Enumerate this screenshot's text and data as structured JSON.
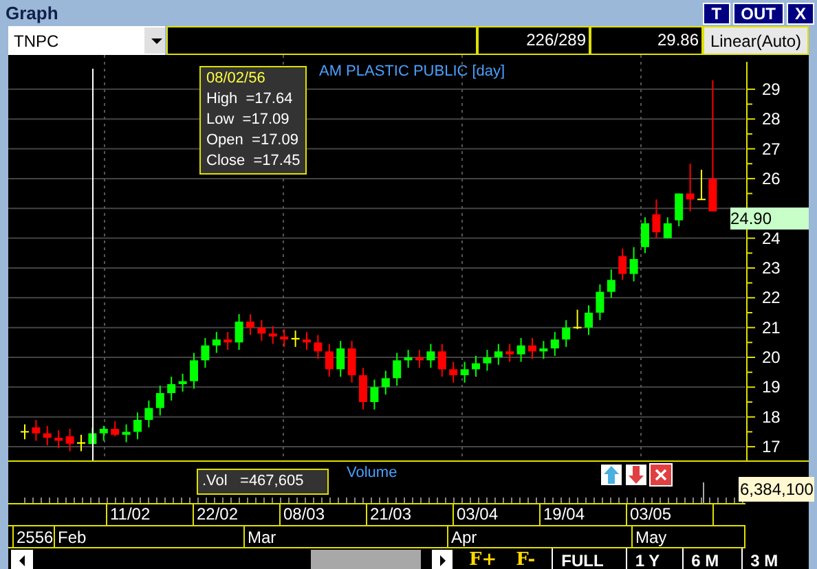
{
  "window": {
    "title": "Graph",
    "buttons": [
      "T",
      "OUT",
      "X"
    ]
  },
  "toolbar": {
    "symbol": "TNPC",
    "position": "226/289",
    "price": "29.86",
    "scale": "Linear(Auto)"
  },
  "chart": {
    "title": "AM PLASTIC PUBLIC [day]",
    "last_price": "24.90",
    "tooltip": {
      "date": "08/02/56",
      "lines": [
        "High  =17.64",
        "Low  =17.09",
        "Open  =17.09",
        "Close  =17.45"
      ]
    },
    "chart_data": {
      "type": "candlestick",
      "grid": true,
      "ylim": [
        16.54,
        30.15
      ],
      "yticks": [
        17,
        18,
        19,
        20,
        21,
        22,
        23,
        24,
        26,
        27,
        28,
        29
      ],
      "ohlc": [
        [
          17.5,
          17.75,
          17.25,
          17.5
        ],
        [
          17.65,
          17.9,
          17.2,
          17.45
        ],
        [
          17.45,
          17.7,
          17.05,
          17.3
        ],
        [
          17.3,
          17.55,
          16.95,
          17.2
        ],
        [
          17.35,
          17.6,
          16.85,
          17.1
        ],
        [
          17.1,
          17.4,
          16.85,
          17.15
        ],
        [
          17.09,
          17.64,
          17.09,
          17.45
        ],
        [
          17.45,
          17.7,
          17.2,
          17.6
        ],
        [
          17.6,
          17.85,
          17.35,
          17.4
        ],
        [
          17.4,
          17.75,
          17.15,
          17.5
        ],
        [
          17.5,
          18.15,
          17.25,
          17.9
        ],
        [
          17.9,
          18.55,
          17.65,
          18.3
        ],
        [
          18.3,
          19.05,
          18.05,
          18.8
        ],
        [
          18.8,
          19.35,
          18.55,
          19.1
        ],
        [
          19.1,
          19.45,
          18.85,
          19.2
        ],
        [
          19.2,
          20.15,
          18.95,
          19.9
        ],
        [
          19.9,
          20.65,
          19.65,
          20.4
        ],
        [
          20.4,
          20.85,
          20.15,
          20.6
        ],
        [
          20.6,
          20.85,
          20.25,
          20.5
        ],
        [
          20.5,
          21.45,
          20.25,
          21.2
        ],
        [
          21.2,
          21.45,
          20.75,
          21.0
        ],
        [
          21.0,
          21.25,
          20.55,
          20.8
        ],
        [
          20.8,
          21.05,
          20.45,
          20.7
        ],
        [
          20.7,
          20.95,
          20.35,
          20.6
        ],
        [
          20.65,
          20.9,
          20.35,
          20.6
        ],
        [
          20.6,
          20.85,
          20.25,
          20.5
        ],
        [
          20.5,
          20.75,
          19.95,
          20.2
        ],
        [
          20.2,
          20.45,
          19.35,
          19.6
        ],
        [
          19.6,
          20.55,
          19.35,
          20.3
        ],
        [
          20.3,
          20.55,
          19.15,
          19.4
        ],
        [
          19.4,
          19.65,
          18.25,
          18.5
        ],
        [
          18.5,
          19.25,
          18.25,
          19.0
        ],
        [
          19.0,
          19.55,
          18.75,
          19.3
        ],
        [
          19.3,
          20.15,
          19.05,
          19.9
        ],
        [
          19.9,
          20.25,
          19.65,
          20.0
        ],
        [
          20.0,
          20.25,
          19.65,
          19.9
        ],
        [
          19.9,
          20.45,
          19.65,
          20.2
        ],
        [
          20.2,
          20.45,
          19.35,
          19.6
        ],
        [
          19.6,
          19.85,
          19.15,
          19.4
        ],
        [
          19.4,
          19.85,
          19.15,
          19.6
        ],
        [
          19.6,
          20.05,
          19.35,
          19.8
        ],
        [
          19.8,
          20.25,
          19.55,
          20.0
        ],
        [
          20.0,
          20.45,
          19.75,
          20.2
        ],
        [
          20.2,
          20.45,
          19.85,
          20.1
        ],
        [
          20.1,
          20.65,
          19.85,
          20.4
        ],
        [
          20.4,
          20.65,
          19.95,
          20.2
        ],
        [
          20.2,
          20.55,
          19.95,
          20.3
        ],
        [
          20.3,
          20.85,
          20.05,
          20.6
        ],
        [
          20.6,
          21.25,
          20.35,
          21.0
        ],
        [
          21.0,
          21.6,
          20.95,
          21.0
        ],
        [
          21.0,
          21.75,
          20.75,
          21.5
        ],
        [
          21.5,
          22.45,
          21.25,
          22.2
        ],
        [
          22.2,
          22.95,
          22.0,
          22.6
        ],
        [
          23.4,
          23.65,
          22.6,
          22.8
        ],
        [
          22.8,
          23.7,
          22.55,
          23.3
        ],
        [
          23.7,
          24.7,
          23.5,
          24.5
        ],
        [
          24.8,
          25.3,
          24.0,
          24.2
        ],
        [
          24.0,
          24.7,
          24.0,
          24.5
        ],
        [
          24.6,
          25.5,
          24.4,
          25.5
        ],
        [
          25.5,
          26.5,
          24.9,
          25.3
        ],
        [
          25.3,
          26.3,
          25.3,
          25.3
        ],
        [
          26.0,
          29.3,
          24.9,
          24.9
        ]
      ]
    }
  },
  "volume": {
    "label": "Volume",
    "reading": ".Vol   =467,605",
    "max": "6,384,100"
  },
  "dates": [
    "11/02",
    "22/02",
    "08/03",
    "21/03",
    "03/04",
    "19/04",
    "03/05"
  ],
  "months": [
    "2556",
    "Feb",
    "Mar",
    "Apr",
    "May"
  ],
  "footer": [
    "F+",
    "F-",
    "FULL",
    "1 Y",
    "6 M",
    "3 M"
  ]
}
